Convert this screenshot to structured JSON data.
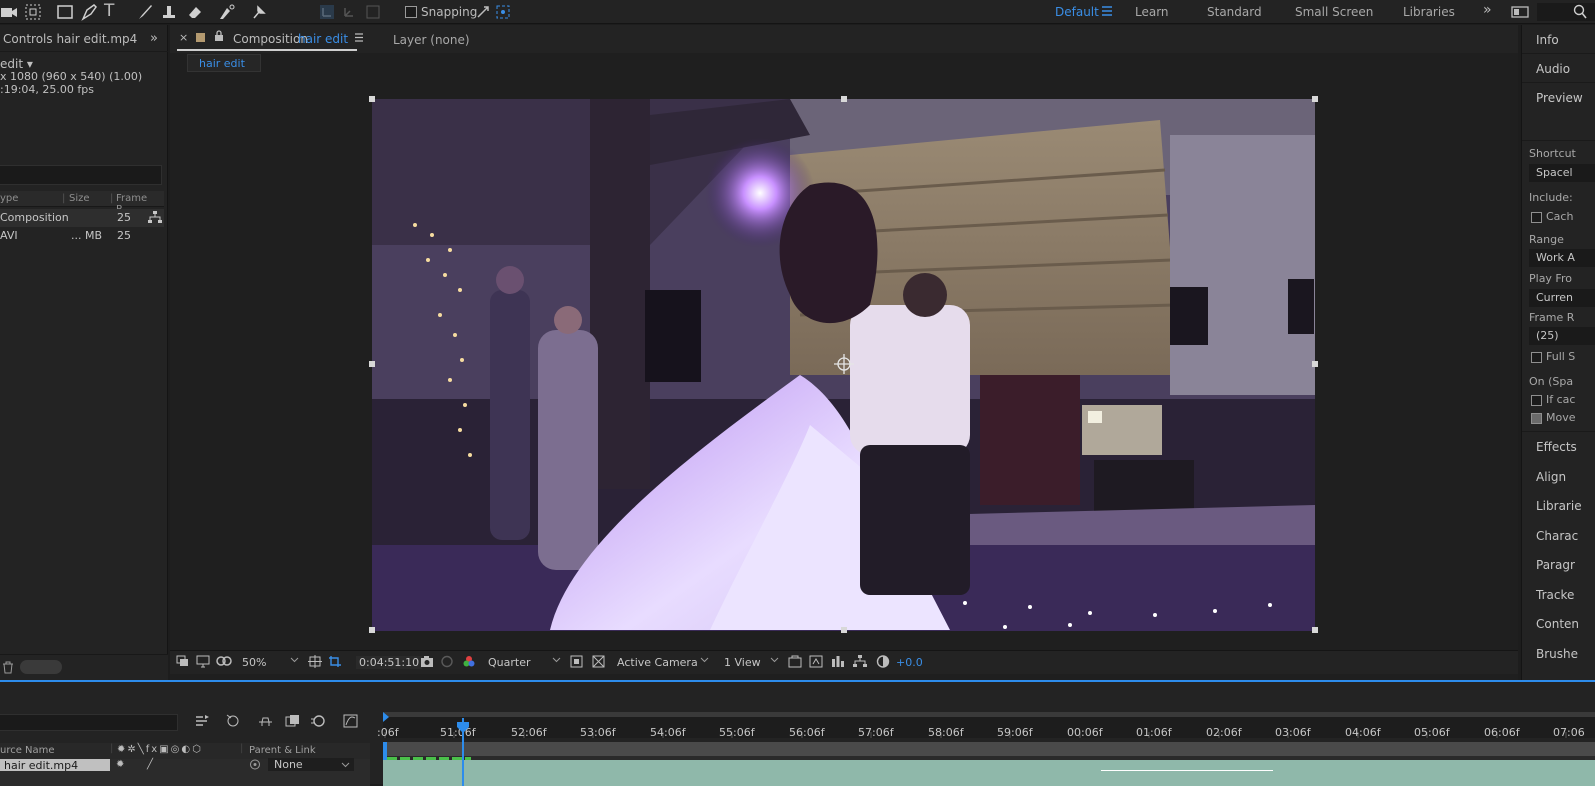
{
  "toolbar": {
    "snapping_label": "Snapping",
    "workspaces": [
      "Default",
      "Learn",
      "Standard",
      "Small Screen",
      "Libraries"
    ]
  },
  "left_panel": {
    "tab_title": "Controls hair edit.mp4",
    "comp_name": "edit ▾",
    "meta_line1": "x 1080  (960 x 540) (1.00)",
    "meta_line2": ":19:04, 25.00 fps",
    "columns": [
      "ype",
      "Size",
      "Frame R..."
    ],
    "rows": [
      {
        "type": "Composition",
        "size": "",
        "frame_rate": "25"
      },
      {
        "type": "AVI",
        "size": "... MB",
        "frame_rate": "25"
      }
    ]
  },
  "comp_panel": {
    "tab_prefix": "Composition",
    "tab_name": "hair edit",
    "layer_tab": "Layer  (none)",
    "sub_tab": "hair edit",
    "zoom": "50%",
    "timecode": "0:04:51:10",
    "resolution": "Quarter",
    "camera": "Active Camera",
    "views": "1 View",
    "exposure": "+0.0"
  },
  "right_panel": {
    "panels": [
      "Info",
      "Audio",
      "Preview"
    ],
    "shortcut_label": "Shortcut",
    "shortcut_value": "Spacel",
    "include_label": "Include:",
    "cache_label": "Cach",
    "range_label": "Range",
    "range_value": "Work A",
    "play_from_label": "Play Fro",
    "play_from_value": "Curren",
    "frame_rate_label": "Frame R",
    "frame_rate_value": "(25)",
    "full_label": "Full S",
    "on_label": "On (Spa",
    "if_cached_label": "If cac",
    "move_label": "Move",
    "more_panels": [
      "Effects",
      "Align",
      "Librarie",
      "Charac",
      "Paragr",
      "Tracke",
      "Conten",
      "Brushe"
    ]
  },
  "timeline": {
    "ruler_labels": [
      ":06f",
      "51:06f",
      "52:06f",
      "53:06f",
      "54:06f",
      "55:06f",
      "56:06f",
      "57:06f",
      "58:06f",
      "59:06f",
      "00:06f",
      "01:06f",
      "02:06f",
      "03:06f",
      "04:06f",
      "05:06f",
      "06:06f",
      "07:06"
    ],
    "col_source_name": "urce Name",
    "col_parent": "Parent & Link",
    "layer_name": "hair edit.mp4",
    "parent_value": "None"
  },
  "colors": {
    "accent": "#3a8ee6",
    "panel": "#232323",
    "viewer_bg": "#1f1f1f",
    "timeline_border": "#2d8ceb"
  }
}
